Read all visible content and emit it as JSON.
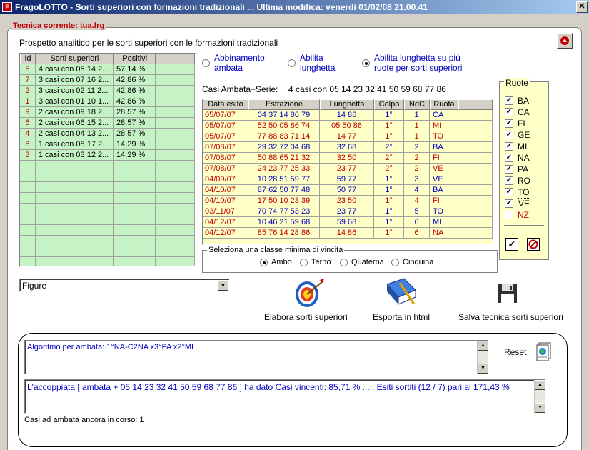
{
  "window": {
    "title": "FragoLOTTO - Sorti superiori con formazioni tradizionali ... Ultima modifica: venerdì 01/02/08 21.00.41",
    "close": "✕"
  },
  "group": {
    "label": "Tecnica corrente: tua.frg"
  },
  "prospetto": {
    "label": "Prospetto analitico per le sorti superiori con le formazioni tradizionali"
  },
  "grid1": {
    "headers": [
      "Id",
      "Sorti superiori",
      "Positivi"
    ],
    "rows": [
      {
        "id": "5",
        "sorti": "4 casi con 05 14 2...",
        "pos": "57,14 %"
      },
      {
        "id": "7",
        "sorti": "3 casi con 07 16 2...",
        "pos": "42,86 %"
      },
      {
        "id": "2",
        "sorti": "3 casi con 02 11 2...",
        "pos": "42,86 %"
      },
      {
        "id": "1",
        "sorti": "3 casi con 01 10 1...",
        "pos": "42,86 %"
      },
      {
        "id": "9",
        "sorti": "2 casi con 09 18 2...",
        "pos": "28,57 %"
      },
      {
        "id": "6",
        "sorti": "2 casi con 06 15 2...",
        "pos": "28,57 %"
      },
      {
        "id": "4",
        "sorti": "2 casi con 04 13 2...",
        "pos": "28,57 %"
      },
      {
        "id": "8",
        "sorti": "1 casi con 08 17 2...",
        "pos": "14,29 %"
      },
      {
        "id": "3",
        "sorti": "1 casi con 03 12 2...",
        "pos": "14,29 %"
      }
    ]
  },
  "options": {
    "abbinamento": "Abbinamento\nambata",
    "abilita_lunghetta": "Abilita\nlunghetta",
    "abilita_piu": "Abilita lunghetta su più\nruote per sorti superiori"
  },
  "casi": {
    "label": "Casi Ambata+Serie:",
    "value": "4 casi con 05 14 23 32 41 50 59 68 77 86"
  },
  "grid2": {
    "headers": [
      "Data esito",
      "Estrazione",
      "Lunghetta",
      "Colpo",
      "NdC",
      "Ruota"
    ],
    "rows": [
      {
        "data": "05/07/07",
        "estr": "04 37 14 86 79",
        "lung": "14 86",
        "colpo": "1°",
        "ndc": "1",
        "ruota": "CA",
        "color": "blue"
      },
      {
        "data": "05/07/07",
        "estr": "52 50 05 86 74",
        "lung": "05 50 86",
        "colpo": "1°",
        "ndc": "1",
        "ruota": "MI",
        "color": "red"
      },
      {
        "data": "05/07/07",
        "estr": "77 88 83 71 14",
        "lung": "14 77",
        "colpo": "1°",
        "ndc": "1",
        "ruota": "TO",
        "color": "red"
      },
      {
        "data": "07/08/07",
        "estr": "29 32 72 04 68",
        "lung": "32 68",
        "colpo": "2°",
        "ndc": "2",
        "ruota": "BA",
        "color": "blue"
      },
      {
        "data": "07/08/07",
        "estr": "50 88 65 21 32",
        "lung": "32 50",
        "colpo": "2°",
        "ndc": "2",
        "ruota": "FI",
        "color": "red"
      },
      {
        "data": "07/08/07",
        "estr": "24 23 77 25 33",
        "lung": "23 77",
        "colpo": "2°",
        "ndc": "2",
        "ruota": "VE",
        "color": "red"
      },
      {
        "data": "04/09/07",
        "estr": "10 28 51 59 77",
        "lung": "59 77",
        "colpo": "1°",
        "ndc": "3",
        "ruota": "VE",
        "color": "blue"
      },
      {
        "data": "04/10/07",
        "estr": "87 62 50 77 48",
        "lung": "50 77",
        "colpo": "1°",
        "ndc": "4",
        "ruota": "BA",
        "color": "blue"
      },
      {
        "data": "04/10/07",
        "estr": "17 50 10 23 39",
        "lung": "23 50",
        "colpo": "1°",
        "ndc": "4",
        "ruota": "FI",
        "color": "red"
      },
      {
        "data": "03/11/07",
        "estr": "70 74 77 53 23",
        "lung": "23 77",
        "colpo": "1°",
        "ndc": "5",
        "ruota": "TO",
        "color": "blue"
      },
      {
        "data": "04/12/07",
        "estr": "10 46 21 59 68",
        "lung": "59 68",
        "colpo": "1°",
        "ndc": "6",
        "ruota": "MI",
        "color": "blue"
      },
      {
        "data": "04/12/07",
        "estr": "85 76 14 28 86",
        "lung": "14 86",
        "colpo": "1°",
        "ndc": "6",
        "ruota": "NA",
        "color": "red"
      }
    ]
  },
  "ruote": {
    "label": "Ruote",
    "items": [
      {
        "name": "BA",
        "checked": true
      },
      {
        "name": "CA",
        "checked": true
      },
      {
        "name": "FI",
        "checked": true
      },
      {
        "name": "GE",
        "checked": true
      },
      {
        "name": "MI",
        "checked": true
      },
      {
        "name": "NA",
        "checked": true
      },
      {
        "name": "PA",
        "checked": true
      },
      {
        "name": "RO",
        "checked": true
      },
      {
        "name": "TO",
        "checked": true
      },
      {
        "name": "VE",
        "checked": true
      },
      {
        "name": "NZ",
        "checked": false
      }
    ]
  },
  "classe": {
    "label": "Seleziona una classe minima di vincita",
    "options": [
      "Ambo",
      "Terno",
      "Quaterna",
      "Cinquina"
    ]
  },
  "combo": {
    "value": "Figure"
  },
  "actions": {
    "elabora": "Elabora sorti superiori",
    "esporta": "Esporta in html",
    "salva": "Salva tecnica sorti superiori"
  },
  "algoritmo": {
    "text": "Algoritmo per ambata: 1°NA-C2NA x3°PA x2°MI"
  },
  "reset": {
    "label": "Reset"
  },
  "result": {
    "text": "L'accoppiata [ ambata + 05 14 23 32 41 50 59 68 77 86 ] ha dato  Casi vincenti: 85,71 % ..... Esiti sortiti (12 / 7) pari al 171,43 %"
  },
  "in_corso": {
    "text": "Casi ad ambata ancora in corso:  1"
  }
}
